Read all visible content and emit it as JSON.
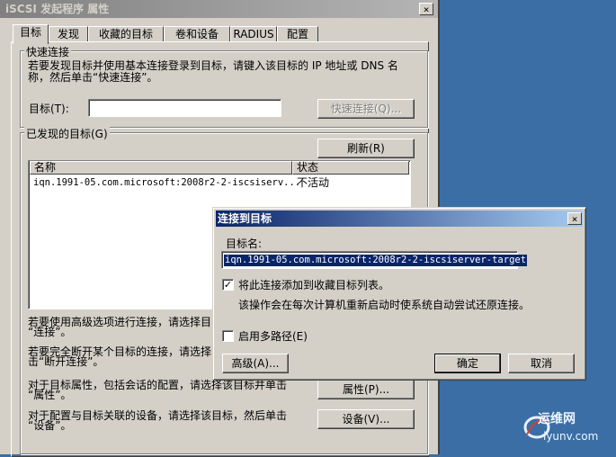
{
  "window": {
    "title": "iSCSI 发起程序 属性",
    "close_glyph": "×"
  },
  "tabs": [
    "目标",
    "发现",
    "收藏的目标",
    "卷和设备",
    "RADIUS",
    "配置"
  ],
  "quick_connect": {
    "group_label": "快速连接",
    "description_line1": "若要发现目标并使用基本连接登录到目标，请键入该目标的 IP 地址或 DNS 名",
    "description_line2": "称，然后单击“快速连接”。",
    "target_label": "目标(T):",
    "target_value": "",
    "button_label": "快速连接(Q)..."
  },
  "discovered": {
    "group_label": "已发现的目标(G)",
    "refresh_label": "刷新(R)",
    "columns": [
      "名称",
      "状态"
    ],
    "rows": [
      {
        "name": "iqn.1991-05.com.microsoft:2008r2-2-iscsiserv...",
        "status": "不活动"
      }
    ]
  },
  "instructions": {
    "connect_line1": "若要使用高级选项进行连接，请选择目",
    "connect_line2": "“连接”。",
    "disconnect_line1": "若要完全断开某个目标的连接，请选择",
    "disconnect_line2": "击“断开连接”。",
    "properties_line1": "对于目标属性，包括会话的配置，请选择该目标并单击",
    "properties_line2": "“属性”。",
    "devices_line1": "对于配置与目标关联的设备，请选择该目标，然后单击",
    "devices_line2": "“设备”。",
    "properties_button": "属性(P)...",
    "devices_button": "设备(V)..."
  },
  "dialog": {
    "title": "连接到目标",
    "close_glyph": "×",
    "target_name_label": "目标名:",
    "target_name_value": "iqn.1991-05.com.microsoft:2008r2-2-iscsiserver-target",
    "add_favorites_label": "将此连接添加到收藏目标列表。",
    "add_favorites_checked": true,
    "check_glyph": "✓",
    "add_favorites_help": "该操作会在每次计算机重新启动时使系统自动尝试还原连接。",
    "multipath_label": "启用多路径(E)",
    "multipath_checked": false,
    "advanced_label": "高级(A)...",
    "ok_label": "确定",
    "cancel_label": "取消"
  },
  "watermark": {
    "text_top": "运维网",
    "text_bottom": "iyunv.com"
  },
  "colors": {
    "desktop": "#3a6ea5",
    "active_title": "#0a246a",
    "face": "#d4d0c8"
  }
}
